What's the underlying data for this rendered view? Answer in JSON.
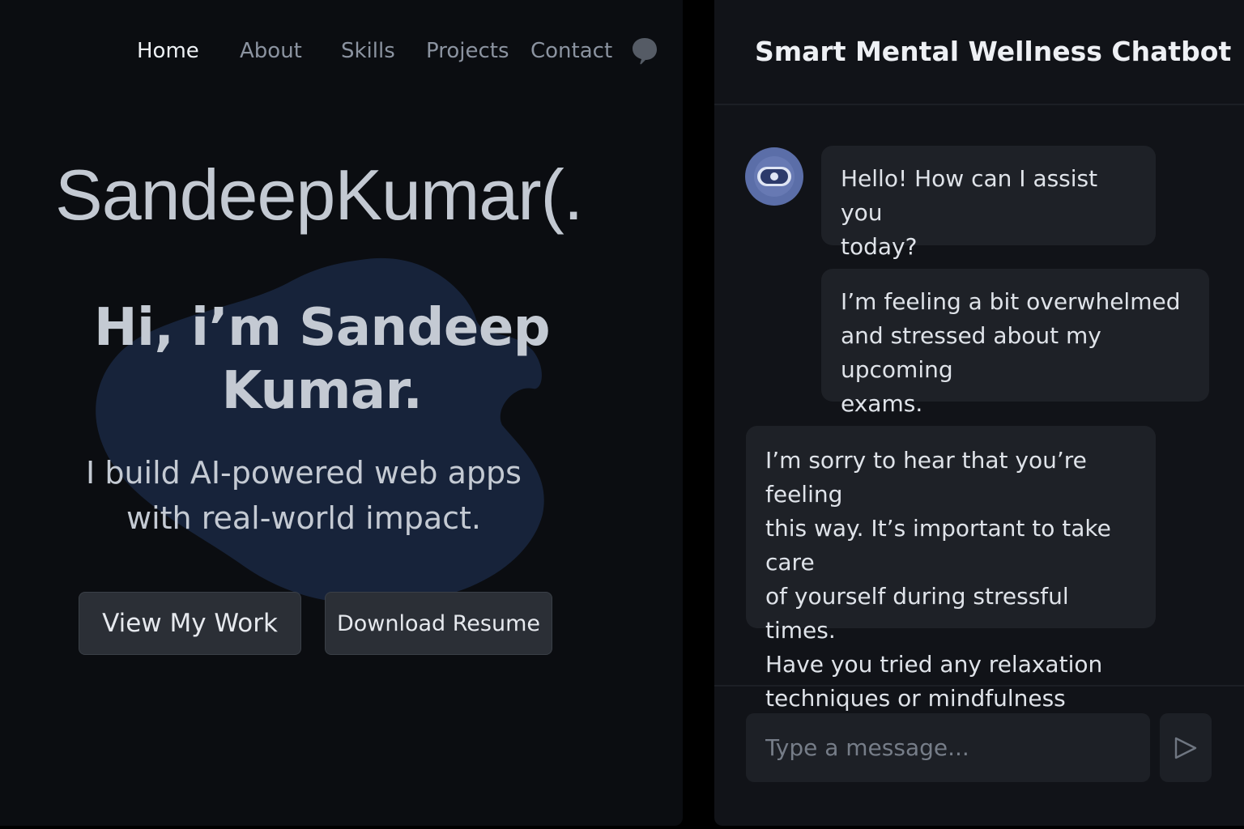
{
  "portfolio": {
    "nav": {
      "items": [
        "Home",
        "About",
        "Skills",
        "Projects",
        "Contact"
      ],
      "active": "Home",
      "chat_icon": "chat-bubble-icon"
    },
    "logo_name": "SandeepKumar(.",
    "hero": {
      "title_line1": "Hi, i’m Sandeep",
      "title_line2": "Kumar.",
      "subtitle_line1": "I build AI-powered web apps",
      "subtitle_line2": "with real-world impact."
    },
    "buttons": {
      "view_work": "View My Work",
      "download_resume": "Download Resume"
    }
  },
  "chatbot": {
    "title": "Smart Mental Wellness Chatbot",
    "avatar_icon": "bot-eye-icon",
    "messages": [
      {
        "sender": "bot",
        "lines": [
          "Hello! How can I assist you",
          "today?"
        ]
      },
      {
        "sender": "user",
        "lines": [
          "I’m feeling a bit overwhelmed",
          "and stressed about my upcoming",
          "exams."
        ]
      },
      {
        "sender": "bot",
        "lines": [
          "I’m sorry to hear that you’re feeling",
          "this way. It’s important to take care",
          "of yourself during stressful times.",
          "Have you tried any relaxation",
          "techniques or mindfulness exercise?"
        ]
      }
    ],
    "input_placeholder": "Type a message...",
    "send_icon": "send-icon"
  },
  "colors": {
    "page_bg": "#0b0d11",
    "panel_bg": "#111318",
    "bubble_bg": "#1e2127",
    "blob": "#17233a",
    "avatar_ring": "#5b6ea8",
    "text_primary": "#c4cad3"
  }
}
